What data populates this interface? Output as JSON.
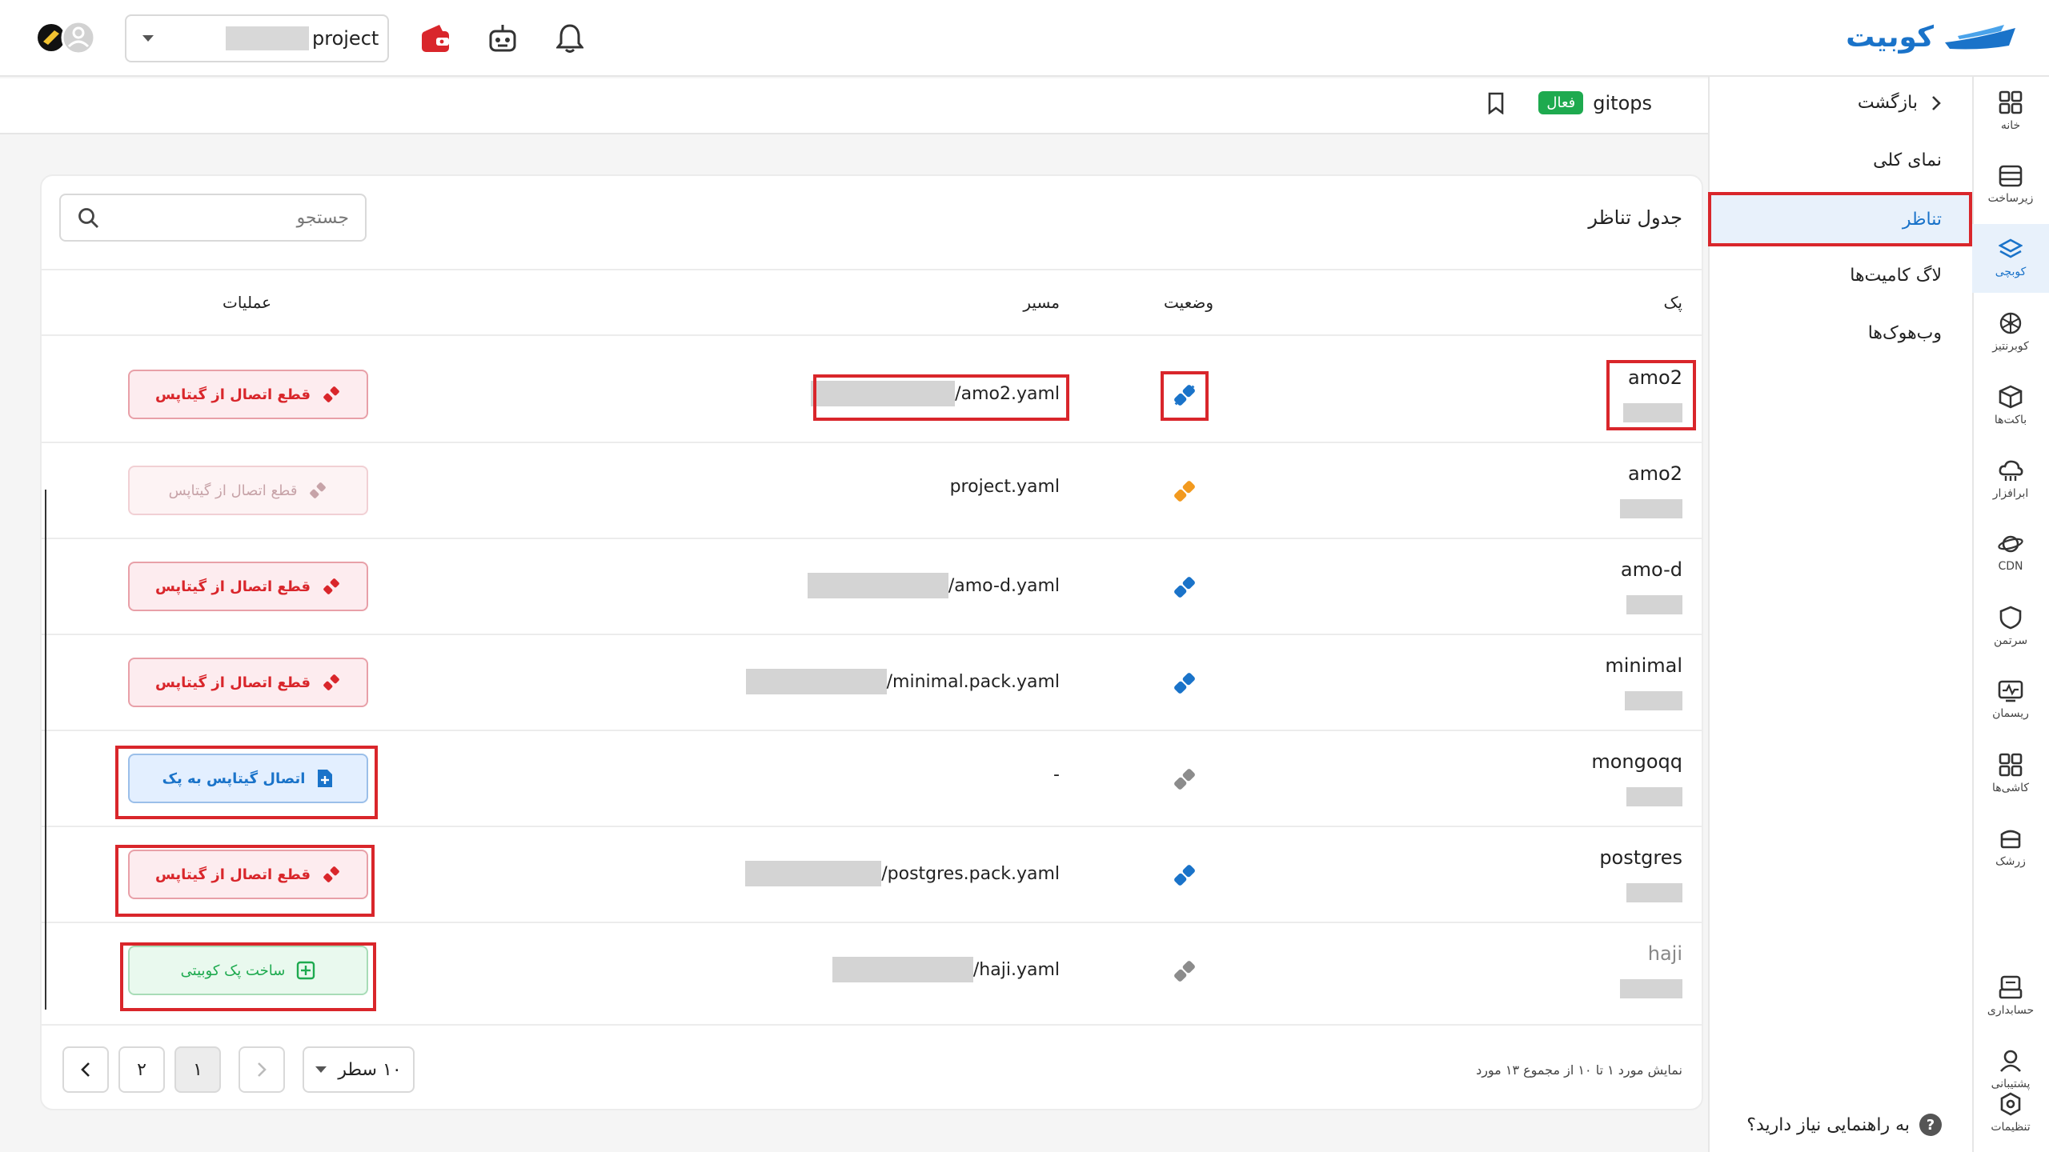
{
  "brand": {
    "name": "کوبیت"
  },
  "topbar": {
    "project_label": "project"
  },
  "rail": [
    {
      "label": "خانه",
      "icon": "grid-icon"
    },
    {
      "label": "زیرساخت",
      "icon": "server-icon"
    },
    {
      "label": "کوبچی",
      "icon": "layers-icon",
      "active": true
    },
    {
      "label": "کوبرنتیز",
      "icon": "kubernetes-icon"
    },
    {
      "label": "باکت‌ها",
      "icon": "box-icon"
    },
    {
      "label": "ابرافزار",
      "icon": "cloud-icon"
    },
    {
      "label": "CDN",
      "icon": "cdn-icon"
    },
    {
      "label": "سرتمن",
      "icon": "shield-icon"
    },
    {
      "label": "ریسمان",
      "icon": "monitor-icon"
    },
    {
      "label": "کاشی‌ها",
      "icon": "tiles-icon"
    },
    {
      "label": "زرشک",
      "icon": "container-icon"
    },
    {
      "label": "حسابداری",
      "icon": "billing-icon"
    },
    {
      "label": "پشتیبانی",
      "icon": "support-icon"
    },
    {
      "label": "تنظیمات",
      "icon": "settings-icon"
    }
  ],
  "sidebar": {
    "back_label": "بازگشت",
    "items": [
      {
        "label": "نمای کلی"
      },
      {
        "label": "تناظر",
        "active": true
      },
      {
        "label": "لاگ کامیت‌ها"
      },
      {
        "label": "وب‌هوک‌ها"
      }
    ],
    "help_label": "به راهنمایی نیاز دارید؟"
  },
  "page": {
    "name": "gitops",
    "status_badge": "فعال"
  },
  "table": {
    "title": "جدول تناظر",
    "search_placeholder": "جستجو",
    "columns": {
      "pack": "پک",
      "status": "وضعیت",
      "path": "مسیر",
      "actions": "عملیات"
    },
    "rows": [
      {
        "pack": "amo2",
        "path": "/amo2.yaml",
        "status": "connected",
        "action": "قطع اتصال از گیتاپس",
        "action_type": "disconnect"
      },
      {
        "pack": "amo2",
        "path": "project.yaml",
        "status": "warning",
        "action": "قطع اتصال از گیتاپس",
        "action_type": "disabled"
      },
      {
        "pack": "amo-d",
        "path": "/amo-d.yaml",
        "status": "connected",
        "action": "قطع اتصال از گیتاپس",
        "action_type": "disconnect"
      },
      {
        "pack": "minimal",
        "path": "/minimal.pack.yaml",
        "status": "connected",
        "action": "قطع اتصال از گیتاپس",
        "action_type": "disconnect"
      },
      {
        "pack": "mongoqq",
        "path": "-",
        "status": "disconnected",
        "action": "اتصال گیتاپس به پک",
        "action_type": "connect"
      },
      {
        "pack": "postgres",
        "path": "/postgres.pack.yaml",
        "status": "connected",
        "action": "قطع اتصال از گیتاپس",
        "action_type": "disconnect"
      },
      {
        "pack": "haji",
        "path": "/haji.yaml",
        "status": "disconnected",
        "action": "ساخت پک کوبیتی",
        "action_type": "create"
      }
    ]
  },
  "pagination": {
    "summary": "نمایش مورد ۱ تا ۱۰ از مجموع ۱۳ مورد",
    "rows_per_page": "۱۰ سطر",
    "pages": [
      "۱",
      "۲"
    ],
    "current_page": "۱"
  },
  "colors": {
    "accent": "#1a73c9",
    "danger": "#d9262b",
    "success": "#1eaa4f",
    "warning": "#f29a1f"
  }
}
